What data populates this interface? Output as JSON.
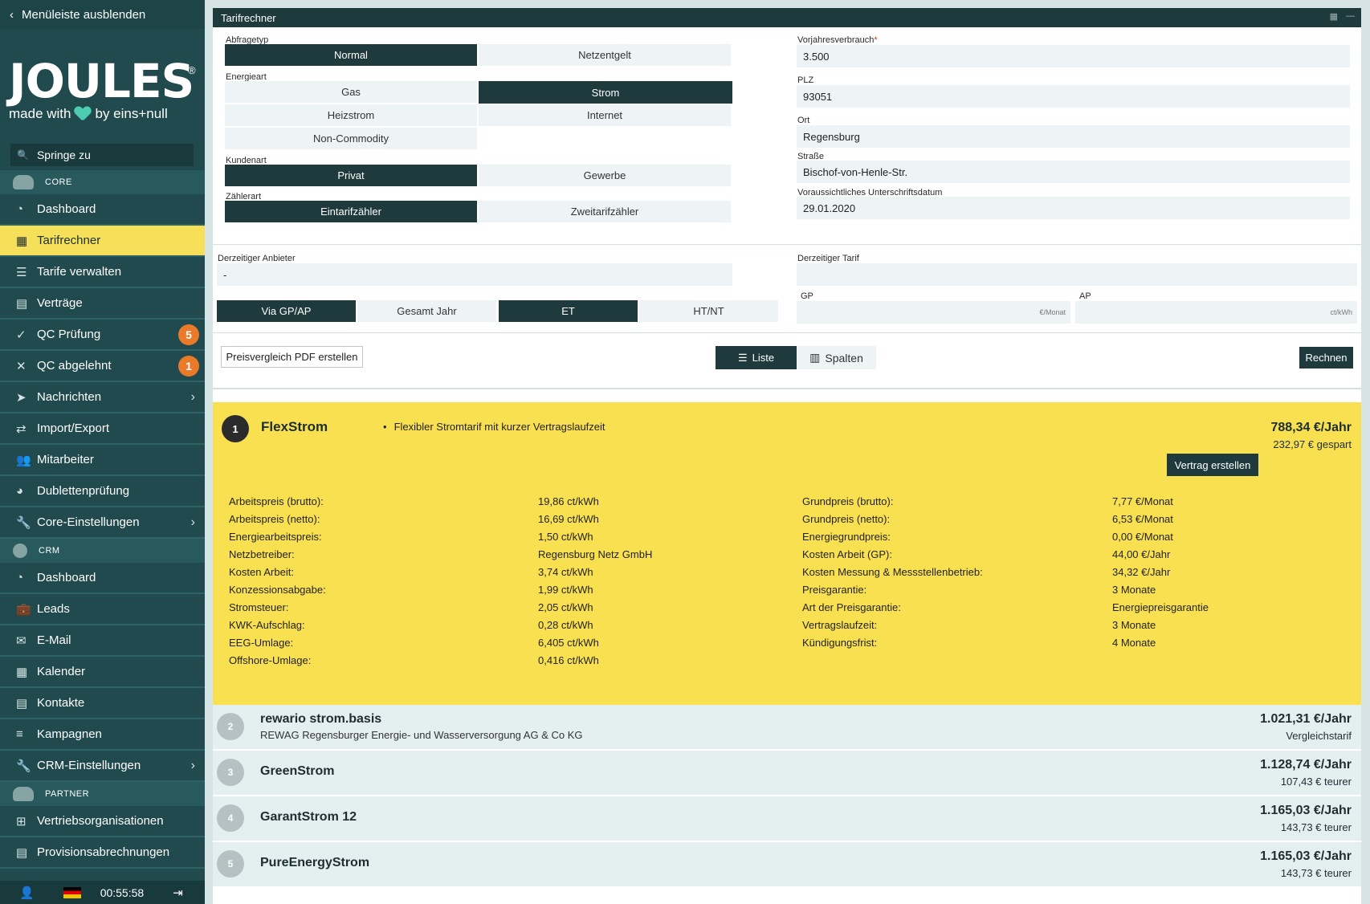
{
  "sidebar": {
    "toggle_label": "Menüleiste ausblenden",
    "logo": {
      "word": "JOULES",
      "sub_before": "made with",
      "sub_after": "by eins+null"
    },
    "jump_placeholder": "Springe zu",
    "sections": {
      "core": "CORE",
      "crm": "CRM",
      "partner": "PARTNER"
    },
    "items": {
      "dashboard": "Dashboard",
      "tarifrechner": "Tarifrechner",
      "tarife": "Tarife verwalten",
      "vertraege": "Verträge",
      "qc_pruefung": "QC Prüfung",
      "qc_pruefung_badge": "5",
      "qc_abgelehnt": "QC abgelehnt",
      "qc_abgelehnt_badge": "1",
      "nachrichten": "Nachrichten",
      "import_export": "Import/Export",
      "mitarbeiter": "Mitarbeiter",
      "dubletten": "Dublettenprüfung",
      "core_einst": "Core-Einstellungen",
      "crm_dashboard": "Dashboard",
      "leads": "Leads",
      "email": "E-Mail",
      "kalender": "Kalender",
      "kontakte": "Kontakte",
      "kampagnen": "Kampagnen",
      "crm_einst": "CRM-Einstellungen",
      "vertriebsorg": "Vertriebsorganisationen",
      "provision": "Provisionsabrechnungen"
    },
    "footer": {
      "time": "00:55:58"
    }
  },
  "window": {
    "title": "Tarifrechner"
  },
  "form": {
    "abfragetyp": {
      "label": "Abfragetyp",
      "options": [
        "Normal",
        "Netzentgelt"
      ],
      "selected": "Normal"
    },
    "energieart": {
      "label": "Energieart",
      "options": [
        "Gas",
        "Strom",
        "Heizstrom",
        "Internet",
        "Non-Commodity"
      ],
      "selected": "Strom"
    },
    "kundenart": {
      "label": "Kundenart",
      "options": [
        "Privat",
        "Gewerbe"
      ],
      "selected": "Privat"
    },
    "zaehlerart": {
      "label": "Zählerart",
      "options": [
        "Eintarifzähler",
        "Zweitarifzähler"
      ],
      "selected": "Eintarifzähler"
    },
    "vorjahresverbrauch": {
      "label": "Vorjahresverbrauch",
      "required": "*",
      "value": "3.500"
    },
    "plz": {
      "label": "PLZ",
      "value": "93051"
    },
    "ort": {
      "label": "Ort",
      "value": "Regensburg"
    },
    "strasse": {
      "label": "Straße",
      "value": "Bischof-von-Henle-Str."
    },
    "unterschrift": {
      "label": "Voraussichtliches Unterschriftsdatum",
      "value": "29.01.2020"
    },
    "anbieter": {
      "label": "Derzeitiger Anbieter",
      "value": "-"
    },
    "tarif": {
      "label": "Derzeitiger Tarif",
      "value": ""
    },
    "calc_mode": {
      "options": [
        "Via GP/AP",
        "Gesamt Jahr"
      ],
      "selected": "Via GP/AP"
    },
    "meter_mode": {
      "options": [
        "ET",
        "HT/NT"
      ],
      "selected": "ET"
    },
    "gp": {
      "label": "GP",
      "unit": "€/Monat",
      "value": ""
    },
    "ap": {
      "label": "AP",
      "unit": "ct/kWh",
      "value": ""
    }
  },
  "toolbar": {
    "pdf_label": "Preisvergleich PDF erstellen",
    "view_list": "Liste",
    "view_columns": "Spalten",
    "view_selected": "Liste",
    "calc_label": "Rechnen"
  },
  "results": [
    {
      "rank": "1",
      "name": "FlexStrom",
      "description": "Flexibler Stromtarif mit kurzer Vertragslaufzeit",
      "price": "788,34 €/Jahr",
      "diff": "232,97 € gespart",
      "action": "Vertrag erstellen",
      "details_left": [
        {
          "k": "Arbeitspreis (brutto):",
          "v": "19,86 ct/kWh"
        },
        {
          "k": "Arbeitspreis (netto):",
          "v": "16,69 ct/kWh"
        },
        {
          "k": "Energiearbeitspreis:",
          "v": "1,50 ct/kWh"
        },
        {
          "k": "Netzbetreiber:",
          "v": "Regensburg Netz GmbH"
        },
        {
          "k": "Kosten Arbeit:",
          "v": "3,74 ct/kWh"
        },
        {
          "k": "Konzessionsabgabe:",
          "v": "1,99 ct/kWh"
        },
        {
          "k": "Stromsteuer:",
          "v": "2,05 ct/kWh"
        },
        {
          "k": "KWK-Aufschlag:",
          "v": "0,28 ct/kWh"
        },
        {
          "k": "EEG-Umlage:",
          "v": "6,405 ct/kWh"
        },
        {
          "k": "Offshore-Umlage:",
          "v": "0,416 ct/kWh"
        }
      ],
      "details_right": [
        {
          "k": "Grundpreis (brutto):",
          "v": "7,77 €/Monat"
        },
        {
          "k": "Grundpreis (netto):",
          "v": "6,53 €/Monat"
        },
        {
          "k": "Energiegrundpreis:",
          "v": "0,00 €/Monat"
        },
        {
          "k": "Kosten Arbeit (GP):",
          "v": "44,00 €/Jahr"
        },
        {
          "k": "Kosten Messung & Messstellenbetrieb:",
          "v": "34,32 €/Jahr"
        },
        {
          "k": "Preisgarantie:",
          "v": "3 Monate"
        },
        {
          "k": "Art der Preisgarantie:",
          "v": "Energiepreisgarantie"
        },
        {
          "k": "Vertragslaufzeit:",
          "v": "3 Monate"
        },
        {
          "k": "Kündigungsfrist:",
          "v": "4 Monate"
        }
      ]
    },
    {
      "rank": "2",
      "name": "rewario strom.basis",
      "provider": "REWAG Regensburger Energie- und Wasserversorgung AG & Co KG",
      "price": "1.021,31 €/Jahr",
      "diff": "Vergleichstarif"
    },
    {
      "rank": "3",
      "name": "GreenStrom",
      "price": "1.128,74 €/Jahr",
      "diff": "107,43 € teurer"
    },
    {
      "rank": "4",
      "name": "GarantStrom 12",
      "price": "1.165,03 €/Jahr",
      "diff": "143,73 € teurer"
    },
    {
      "rank": "5",
      "name": "PureEnergyStrom",
      "price": "1.165,03 €/Jahr",
      "diff": "143,73 € teurer"
    }
  ],
  "colors": {
    "accent": "#f9e050",
    "sidebar": "#204a4d",
    "dark": "#1f3a3d",
    "badge": "#e87a2a",
    "light": "#eef4f5"
  }
}
